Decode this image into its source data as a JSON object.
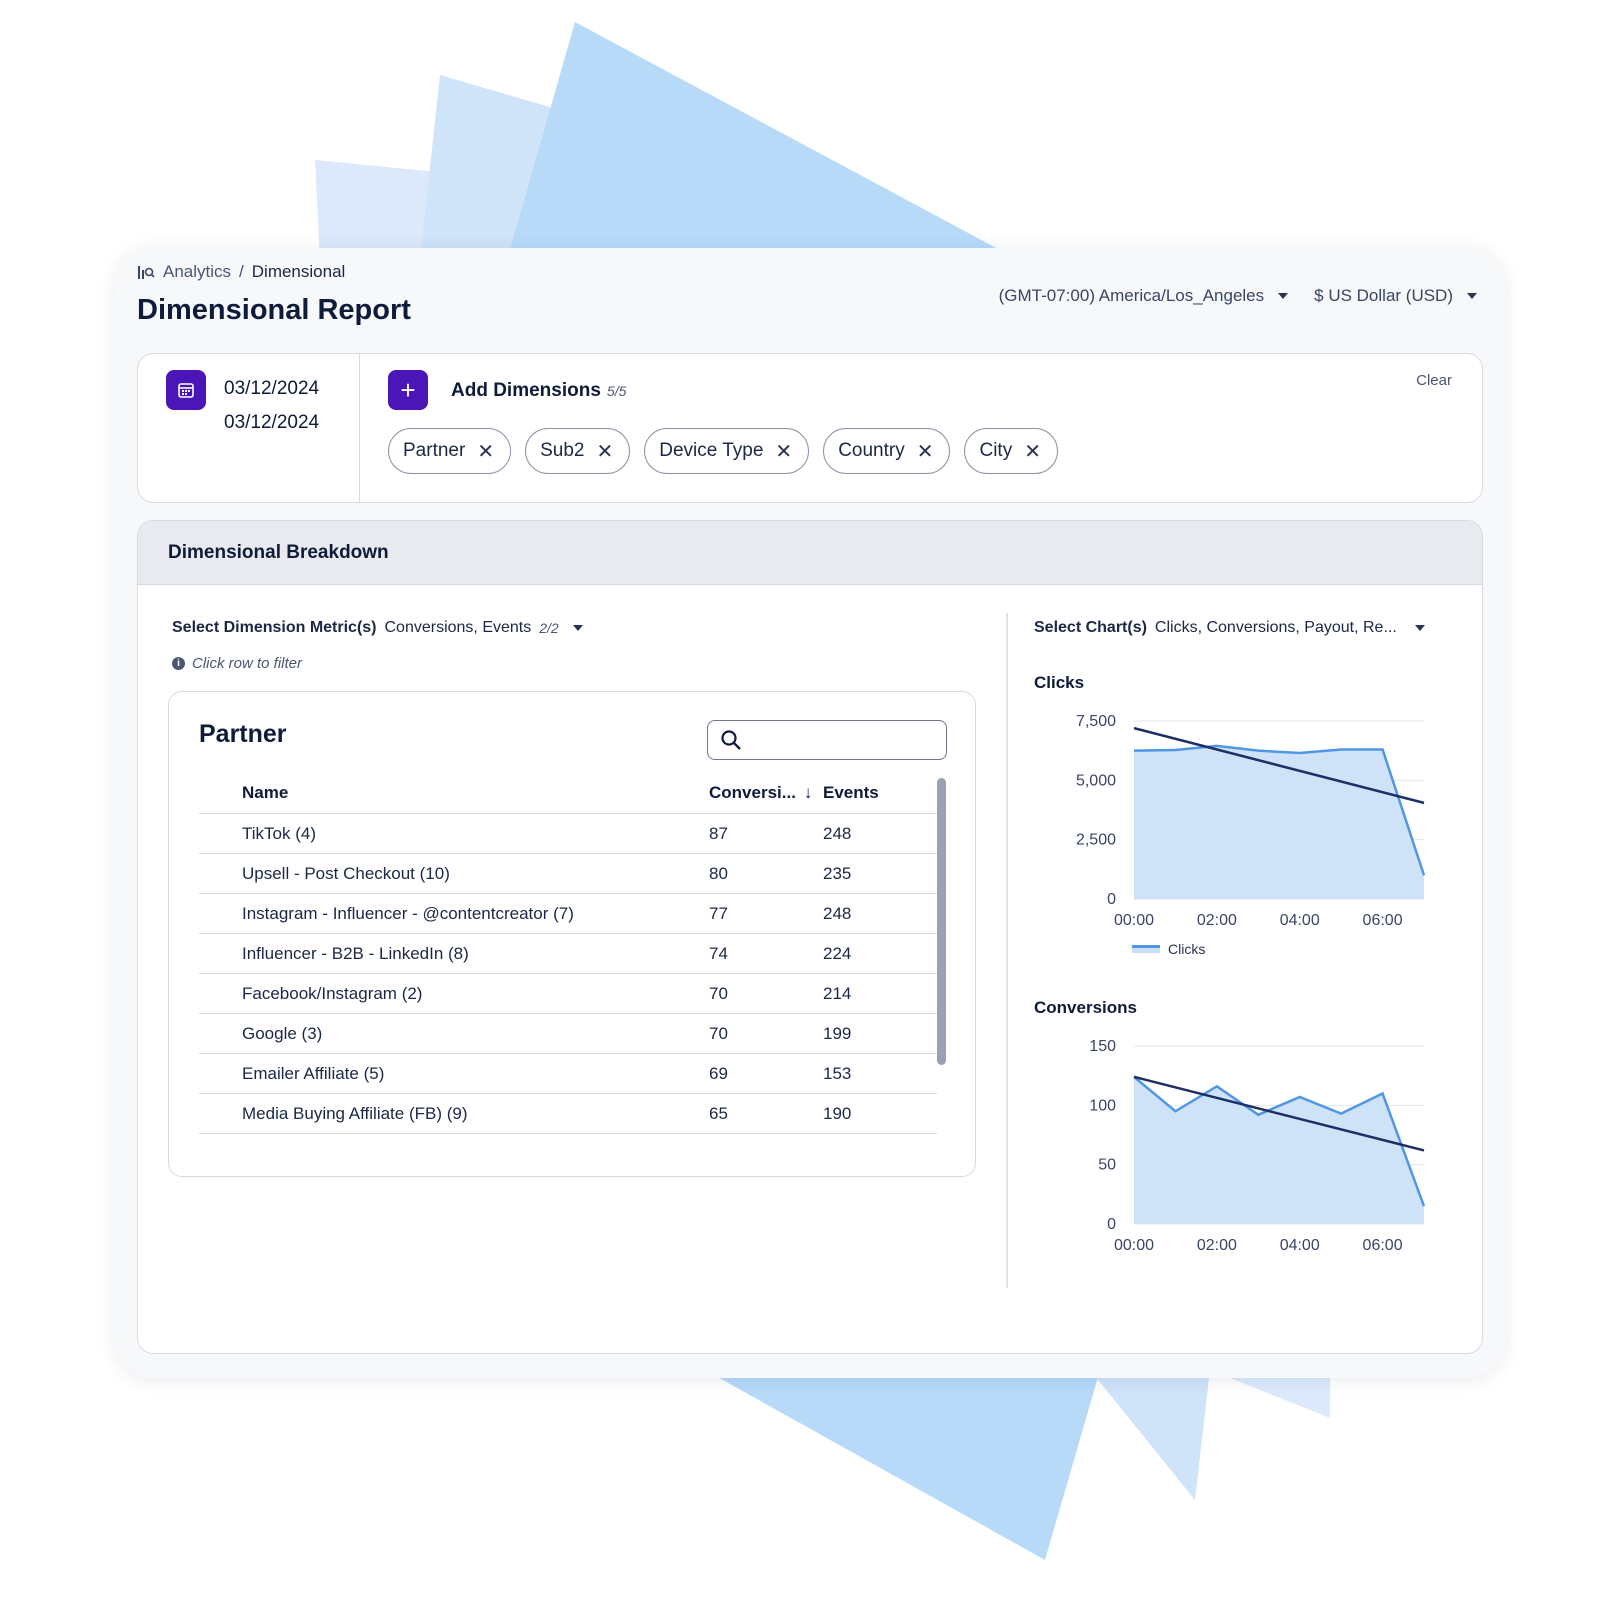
{
  "breadcrumb": {
    "parent": "Analytics",
    "separator": "/",
    "current": "Dimensional"
  },
  "page_title": "Dimensional Report",
  "header": {
    "timezone": "(GMT-07:00) America/Los_Angeles",
    "currency": "$ US Dollar (USD)"
  },
  "filters": {
    "date_start": "03/12/2024",
    "date_end": "03/12/2024",
    "add_label": "Add Dimensions",
    "add_count": "5/5",
    "clear_label": "Clear",
    "chips": [
      "Partner",
      "Sub2",
      "Device Type",
      "Country",
      "City"
    ]
  },
  "breakdown": {
    "title": "Dimensional Breakdown",
    "metric_label": "Select Dimension Metric(s)",
    "metric_value": "Conversions, Events",
    "metric_count": "2/2",
    "hint": "Click row to filter",
    "chart_label": "Select Chart(s)",
    "chart_value": "Clicks, Conversions, Payout, Re..."
  },
  "table": {
    "title": "Partner",
    "search_placeholder": "",
    "columns": [
      "Name",
      "Conversi...",
      "Events"
    ],
    "rows": [
      {
        "name": "TikTok (4)",
        "conversions": "87",
        "events": "248"
      },
      {
        "name": "Upsell - Post Checkout (10)",
        "conversions": "80",
        "events": "235"
      },
      {
        "name": "Instagram - Influencer - @contentcreator (7)",
        "conversions": "77",
        "events": "248"
      },
      {
        "name": "Influencer - B2B - LinkedIn (8)",
        "conversions": "74",
        "events": "224"
      },
      {
        "name": "Facebook/Instagram (2)",
        "conversions": "70",
        "events": "214"
      },
      {
        "name": "Google (3)",
        "conversions": "70",
        "events": "199"
      },
      {
        "name": "Emailer Affiliate (5)",
        "conversions": "69",
        "events": "153"
      },
      {
        "name": "Media Buying Affiliate (FB) (9)",
        "conversions": "65",
        "events": "190"
      }
    ]
  },
  "colors": {
    "accent": "#4b16b8",
    "area_fill": "#c9dff7",
    "area_line": "#4f97e3",
    "trend_line": "#1c2f66"
  },
  "chart_data": [
    {
      "type": "area",
      "title": "Clicks",
      "x": [
        "00:00",
        "01:00",
        "02:00",
        "03:00",
        "04:00",
        "05:00",
        "06:00",
        "07:00"
      ],
      "xticks": [
        "00:00",
        "02:00",
        "04:00",
        "06:00"
      ],
      "yticks": [
        "0",
        "2,500",
        "5,000",
        "7,500"
      ],
      "ylim": [
        0,
        7500
      ],
      "series": [
        {
          "name": "Clicks",
          "values": [
            6250,
            6280,
            6450,
            6250,
            6150,
            6300,
            6300,
            1000
          ]
        }
      ],
      "trend": [
        7200,
        4050
      ],
      "legend": "bottom"
    },
    {
      "type": "area",
      "title": "Conversions",
      "x": [
        "00:00",
        "01:00",
        "02:00",
        "03:00",
        "04:00",
        "05:00",
        "06:00",
        "07:00"
      ],
      "xticks": [
        "00:00",
        "02:00",
        "04:00",
        "06:00"
      ],
      "yticks": [
        "0",
        "50",
        "100",
        "150"
      ],
      "ylim": [
        0,
        150
      ],
      "series": [
        {
          "values": [
            124,
            95,
            116,
            92,
            107,
            93,
            110,
            15
          ]
        }
      ],
      "trend": [
        124,
        62
      ]
    }
  ]
}
